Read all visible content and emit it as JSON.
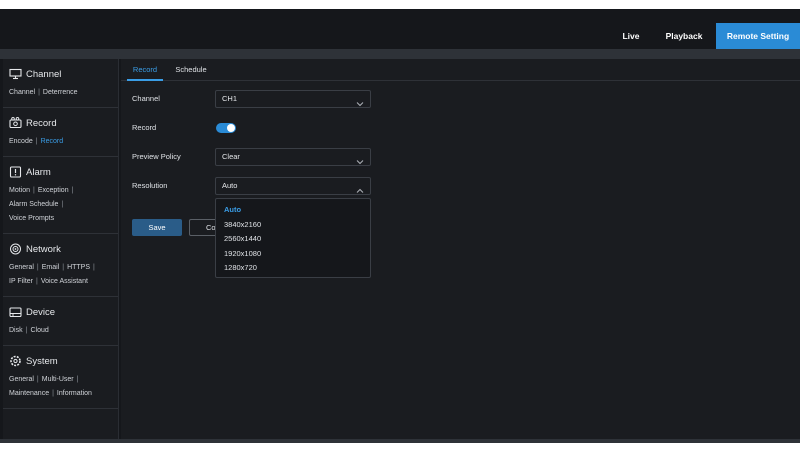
{
  "topnav": {
    "live": "Live",
    "playback": "Playback",
    "remote_setting": "Remote Setting"
  },
  "sidebar": {
    "channel": {
      "title": "Channel",
      "icon": "monitor-icon",
      "links": [
        "Channel",
        "Deterrence"
      ]
    },
    "record": {
      "title": "Record",
      "icon": "record-icon",
      "links": [
        "Encode",
        "Record"
      ],
      "active": "Record"
    },
    "alarm": {
      "title": "Alarm",
      "icon": "alarm-icon",
      "links": [
        "Motion",
        "Exception",
        "Alarm Schedule",
        "Voice Prompts"
      ]
    },
    "network": {
      "title": "Network",
      "icon": "network-icon",
      "links": [
        "General",
        "Email",
        "HTTPS",
        "IP Filter",
        "Voice Assistant"
      ]
    },
    "device": {
      "title": "Device",
      "icon": "disk-icon",
      "links": [
        "Disk",
        "Cloud"
      ]
    },
    "system": {
      "title": "System",
      "icon": "gear-icon",
      "links": [
        "General",
        "Multi-User",
        "Maintenance",
        "Information"
      ]
    }
  },
  "tabs": {
    "record": "Record",
    "schedule": "Schedule",
    "active": "Record"
  },
  "form": {
    "channel_label": "Channel",
    "channel_value": "CH1",
    "record_label": "Record",
    "record_enabled": true,
    "preview_policy_label": "Preview Policy",
    "preview_policy_value": "Clear",
    "resolution_label": "Resolution",
    "resolution_value": "Auto",
    "resolution_options": [
      "Auto",
      "3840x2160",
      "2560x1440",
      "1920x1080",
      "1280x720"
    ],
    "save_label": "Save",
    "copy_label": "Co"
  },
  "colors": {
    "accent": "#2a8bd6",
    "link_active": "#3a9de6",
    "background": "#15171b",
    "panel": "#1a1c20"
  }
}
